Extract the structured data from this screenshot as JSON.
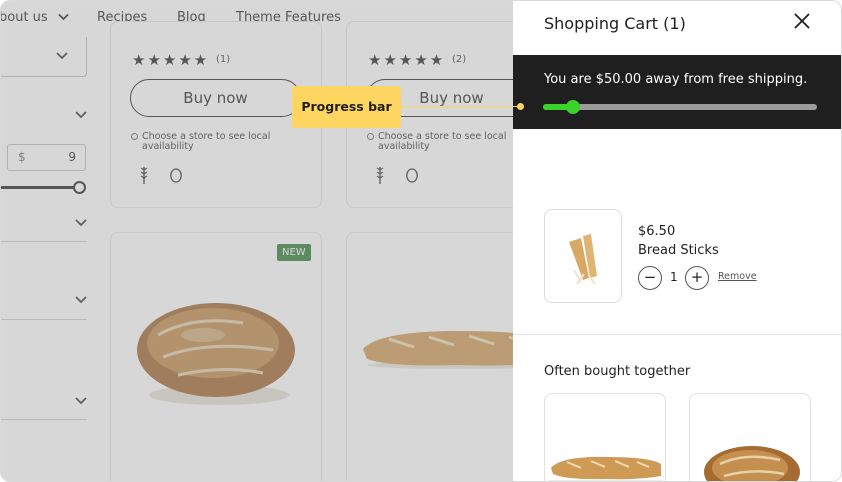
{
  "nav": {
    "items": [
      {
        "label": "bout us",
        "has_chevron": true
      },
      {
        "label": "Recipes"
      },
      {
        "label": "Blog"
      },
      {
        "label": "Theme Features"
      }
    ]
  },
  "filters": {
    "price": {
      "currency": "$",
      "max_value": "9"
    }
  },
  "products": [
    {
      "rating_stars": "★★★★★",
      "rating_count": "(1)",
      "buy_label": "Buy now",
      "store_note": "Choose a store to see local availability"
    },
    {
      "rating_stars": "★★★★★",
      "rating_count": "(2)",
      "buy_label": "Buy now",
      "store_note": "Choose a store to see local availability"
    }
  ],
  "product_row2": {
    "badge": "NEW"
  },
  "cart": {
    "title": "Shopping Cart (1)",
    "shipping_message": "You are $50.00 away from free shipping.",
    "shipping_progress_fraction": 0.11,
    "colors": {
      "progress_fill": "#39d32a",
      "progress_track": "#9c9c9c",
      "bar_bg": "#1f1f1f"
    },
    "items": [
      {
        "price": "$6.50",
        "name": "Bread Sticks",
        "quantity": "1",
        "minus": "−",
        "plus": "+",
        "remove_label": "Remove"
      }
    ],
    "often_bought_title": "Often bought together"
  },
  "annotation": {
    "label": "Progress bar",
    "color": "#ffd562"
  },
  "icons": [
    "chevron-down-icon",
    "close-icon",
    "wheat-icon",
    "egg-icon",
    "star-icon"
  ]
}
